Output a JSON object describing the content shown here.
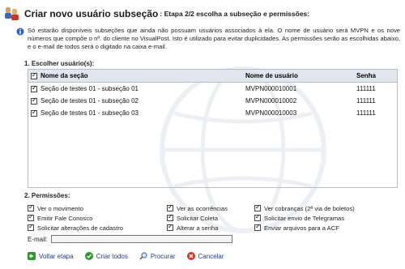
{
  "header": {
    "title": "Criar novo usuário subseção",
    "subtitle": ": Etapa 2/2 escolha a subseção e permissões:"
  },
  "info": {
    "text": "Só estarão disponíveis subseções que ainda não possuam usuários associados à ela. O nome de usuário será MVPN e os nove números que compõe o nº. do cliente no VisualPost. Isto é utilizado para evitar duplicidades. As permissões serão as escolhidas abaixo, e o e-mail de todos será o digitado na caixa e-mail."
  },
  "users_section": {
    "title": "1.   Escolher usuário(s):",
    "columns": [
      "Nome da seção",
      "Nome de usuário",
      "Senha"
    ],
    "header_checked": true,
    "rows": [
      {
        "checked": true,
        "name": "Seção de testes 01 - subseção 01",
        "user": "MVPN000010001",
        "pass": "111111"
      },
      {
        "checked": true,
        "name": "Seção de testes 01 - subseção 02",
        "user": "MVPN000010002",
        "pass": "111111"
      },
      {
        "checked": true,
        "name": "Seção de testes 01 - subseção 03",
        "user": "MVPN000010003",
        "pass": "111111"
      }
    ]
  },
  "permissions_section": {
    "title": "2.   Permissões:",
    "items": [
      {
        "label": "Ver o movimento",
        "checked": true
      },
      {
        "label": "Ver as ocorrências",
        "checked": true
      },
      {
        "label": "Ver cobranças (2ª via de boletos)",
        "checked": true
      },
      {
        "label": "Emitir Fale Conosco",
        "checked": true
      },
      {
        "label": "Solicitar Coleta",
        "checked": true
      },
      {
        "label": "Solicitar envio de Telegramas",
        "checked": true
      },
      {
        "label": "Solicitar alterações de cadastro",
        "checked": true
      },
      {
        "label": "Alterar a senha",
        "checked": true
      },
      {
        "label": "Enviar arquivos para a ACF",
        "checked": true
      }
    ]
  },
  "email": {
    "label": "E-mail:",
    "value": ""
  },
  "actions": {
    "back": "Voltar etapa",
    "create": "Criar todos",
    "search": "Procurar",
    "cancel": "Cancelar"
  },
  "icons": {
    "title": "users-group-icon",
    "info": "info-icon",
    "back": "back-arrow-icon",
    "create": "check-icon",
    "search": "magnifier-icon",
    "cancel": "cancel-icon"
  },
  "colors": {
    "link": "#233a8a",
    "table_header": "#e3e6ee",
    "green": "#2e9a2e",
    "red": "#d9341f"
  }
}
